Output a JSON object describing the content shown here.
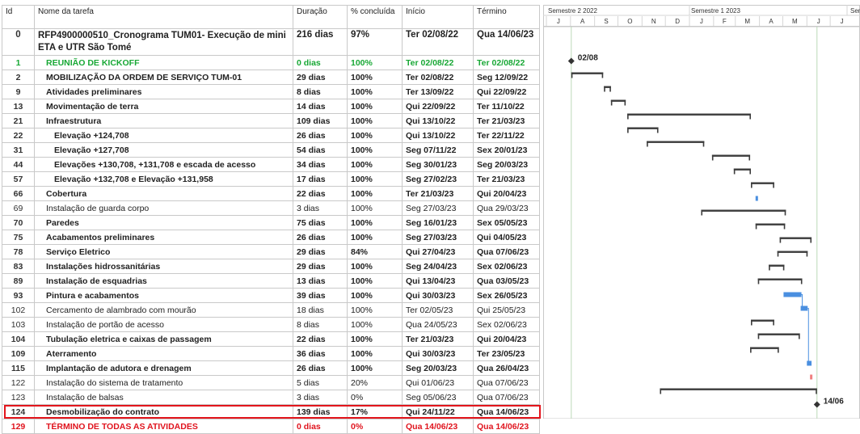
{
  "columns": [
    "Id",
    "Nome da tarefa",
    "Duração",
    "% concluída",
    "Início",
    "Término"
  ],
  "timescale": {
    "tiers": [
      "Semestre 2 2022",
      "Semestre 1 2023",
      "Seme"
    ],
    "months": [
      "J",
      "A",
      "S",
      "O",
      "N",
      "D",
      "J",
      "F",
      "M",
      "A",
      "M",
      "J",
      "J"
    ]
  },
  "tasks": [
    {
      "id": "0",
      "name": "RFP4900000510_Cronograma TUM01- Execução de mini ETA e UTR São Tomé",
      "duration": "216 dias",
      "pct": "97%",
      "start": "Ter 02/08/22",
      "end": "Qua 14/06/23",
      "style": "summary",
      "level": 0
    },
    {
      "id": "1",
      "name": "REUNIÃO DE KICKOFF",
      "duration": "0 dias",
      "pct": "100%",
      "start": "Ter 02/08/22",
      "end": "Ter 02/08/22",
      "style": "green",
      "level": 1
    },
    {
      "id": "2",
      "name": "MOBILIZAÇÃO DA ORDEM DE SERVIÇO TUM-01",
      "duration": "29 dias",
      "pct": "100%",
      "start": "Ter 02/08/22",
      "end": "Seg 12/09/22",
      "style": "bold",
      "level": 1
    },
    {
      "id": "9",
      "name": "Atividades preliminares",
      "duration": "8 dias",
      "pct": "100%",
      "start": "Ter 13/09/22",
      "end": "Qui 22/09/22",
      "style": "bold",
      "level": 1
    },
    {
      "id": "13",
      "name": "Movimentação de terra",
      "duration": "14 dias",
      "pct": "100%",
      "start": "Qui 22/09/22",
      "end": "Ter 11/10/22",
      "style": "bold",
      "level": 1
    },
    {
      "id": "21",
      "name": "Infraestrutura",
      "duration": "109 dias",
      "pct": "100%",
      "start": "Qui 13/10/22",
      "end": "Ter 21/03/23",
      "style": "bold",
      "level": 1
    },
    {
      "id": "22",
      "name": "Elevação +124,708",
      "duration": "26 dias",
      "pct": "100%",
      "start": "Qui 13/10/22",
      "end": "Ter 22/11/22",
      "style": "bold",
      "level": 2
    },
    {
      "id": "31",
      "name": "Elevação +127,708",
      "duration": "54 dias",
      "pct": "100%",
      "start": "Seg 07/11/22",
      "end": "Sex 20/01/23",
      "style": "bold",
      "level": 2
    },
    {
      "id": "44",
      "name": "Elevações +130,708, +131,708 e escada de acesso",
      "duration": "34 dias",
      "pct": "100%",
      "start": "Seg 30/01/23",
      "end": "Seg 20/03/23",
      "style": "bold",
      "level": 2
    },
    {
      "id": "57",
      "name": "Elevação +132,708 e Elevação +131,958",
      "duration": "17 dias",
      "pct": "100%",
      "start": "Seg 27/02/23",
      "end": "Ter 21/03/23",
      "style": "bold",
      "level": 2
    },
    {
      "id": "66",
      "name": "Cobertura",
      "duration": "22 dias",
      "pct": "100%",
      "start": "Ter 21/03/23",
      "end": "Qui 20/04/23",
      "style": "bold",
      "level": 1
    },
    {
      "id": "69",
      "name": "Instalação de guarda corpo",
      "duration": "3 dias",
      "pct": "100%",
      "start": "Seg 27/03/23",
      "end": "Qua 29/03/23",
      "style": "normal",
      "level": 1
    },
    {
      "id": "70",
      "name": "Paredes",
      "duration": "75 dias",
      "pct": "100%",
      "start": "Seg 16/01/23",
      "end": "Sex 05/05/23",
      "style": "bold",
      "level": 1
    },
    {
      "id": "75",
      "name": "Acabamentos preliminares",
      "duration": "26 dias",
      "pct": "100%",
      "start": "Seg 27/03/23",
      "end": "Qui 04/05/23",
      "style": "bold",
      "level": 1
    },
    {
      "id": "78",
      "name": "Serviço Eletrico",
      "duration": "29 dias",
      "pct": "84%",
      "start": "Qui 27/04/23",
      "end": "Qua 07/06/23",
      "style": "bold",
      "level": 1
    },
    {
      "id": "83",
      "name": "Instalações hidrossanitárias",
      "duration": "29 dias",
      "pct": "100%",
      "start": "Seg 24/04/23",
      "end": "Sex 02/06/23",
      "style": "bold",
      "level": 1
    },
    {
      "id": "89",
      "name": "Instalação de esquadrias",
      "duration": "13 dias",
      "pct": "100%",
      "start": "Qui 13/04/23",
      "end": "Qua 03/05/23",
      "style": "bold",
      "level": 1
    },
    {
      "id": "93",
      "name": "Pintura e acabamentos",
      "duration": "39 dias",
      "pct": "100%",
      "start": "Qui 30/03/23",
      "end": "Sex 26/05/23",
      "style": "bold",
      "level": 1
    },
    {
      "id": "102",
      "name": "Cercamento de alambrado com mourão",
      "duration": "18 dias",
      "pct": "100%",
      "start": "Ter 02/05/23",
      "end": "Qui 25/05/23",
      "style": "normal",
      "level": 1
    },
    {
      "id": "103",
      "name": "Instalação de portão de acesso",
      "duration": "8 dias",
      "pct": "100%",
      "start": "Qua 24/05/23",
      "end": "Sex 02/06/23",
      "style": "normal",
      "level": 1
    },
    {
      "id": "104",
      "name": "Tubulação eletrica e caixas de passagem",
      "duration": "22 dias",
      "pct": "100%",
      "start": "Ter 21/03/23",
      "end": "Qui 20/04/23",
      "style": "bold",
      "level": 1
    },
    {
      "id": "109",
      "name": "Aterramento",
      "duration": "36 dias",
      "pct": "100%",
      "start": "Qui 30/03/23",
      "end": "Ter 23/05/23",
      "style": "bold",
      "level": 1
    },
    {
      "id": "115",
      "name": "Implantação de adutora e drenagem",
      "duration": "26 dias",
      "pct": "100%",
      "start": "Seg 20/03/23",
      "end": "Qua 26/04/23",
      "style": "bold",
      "level": 1
    },
    {
      "id": "122",
      "name": "Instalação do sistema de tratamento",
      "duration": "5 dias",
      "pct": "20%",
      "start": "Qui 01/06/23",
      "end": "Qua 07/06/23",
      "style": "normal",
      "level": 1
    },
    {
      "id": "123",
      "name": "Instalação de balsas",
      "duration": "3 dias",
      "pct": "0%",
      "start": "Seg 05/06/23",
      "end": "Qua 07/06/23",
      "style": "normal",
      "level": 1
    },
    {
      "id": "124",
      "name": "Desmobilização do contrato",
      "duration": "139 dias",
      "pct": "17%",
      "start": "Qui 24/11/22",
      "end": "Qua 14/06/23",
      "style": "bold",
      "level": 1
    },
    {
      "id": "129",
      "name": "TÉRMINO DE TODAS AS ATIVIDADES",
      "duration": "0 dias",
      "pct": "0%",
      "start": "Qua 14/06/23",
      "end": "Qua 14/06/23",
      "style": "red",
      "level": 1
    }
  ],
  "chart_data": {
    "type": "gantt",
    "timeline_start": "2022-07-01",
    "timeline_end": "2023-07-31",
    "bars": [
      {
        "id": "2",
        "start": "2022-08-02",
        "end": "2022-09-12",
        "color": "#3c3c3c"
      },
      {
        "id": "9",
        "start": "2022-09-13",
        "end": "2022-09-22",
        "color": "#3c3c3c"
      },
      {
        "id": "13",
        "start": "2022-09-22",
        "end": "2022-10-11",
        "color": "#3c3c3c"
      },
      {
        "id": "21",
        "start": "2022-10-13",
        "end": "2023-03-21",
        "color": "#3c3c3c"
      },
      {
        "id": "22",
        "start": "2022-10-13",
        "end": "2022-11-22",
        "color": "#3c3c3c"
      },
      {
        "id": "31",
        "start": "2022-11-07",
        "end": "2023-01-20",
        "color": "#3c3c3c"
      },
      {
        "id": "44",
        "start": "2023-01-30",
        "end": "2023-03-20",
        "color": "#3c3c3c"
      },
      {
        "id": "57",
        "start": "2023-02-27",
        "end": "2023-03-21",
        "color": "#3c3c3c"
      },
      {
        "id": "66",
        "start": "2023-03-21",
        "end": "2023-04-20",
        "color": "#3c3c3c"
      },
      {
        "id": "69",
        "start": "2023-03-27",
        "end": "2023-03-29",
        "color": "#4a8fe0"
      },
      {
        "id": "70",
        "start": "2023-01-16",
        "end": "2023-05-05",
        "color": "#3c3c3c"
      },
      {
        "id": "75",
        "start": "2023-03-27",
        "end": "2023-05-04",
        "color": "#3c3c3c"
      },
      {
        "id": "78",
        "start": "2023-04-27",
        "end": "2023-06-07",
        "color": "#3c3c3c"
      },
      {
        "id": "83",
        "start": "2023-04-24",
        "end": "2023-06-02",
        "color": "#3c3c3c"
      },
      {
        "id": "89",
        "start": "2023-04-13",
        "end": "2023-05-03",
        "color": "#3c3c3c"
      },
      {
        "id": "93",
        "start": "2023-03-30",
        "end": "2023-05-26",
        "color": "#3c3c3c"
      },
      {
        "id": "102",
        "start": "2023-05-02",
        "end": "2023-05-25",
        "color": "#4a8fe0"
      },
      {
        "id": "103",
        "start": "2023-05-24",
        "end": "2023-06-02",
        "color": "#4a8fe0"
      },
      {
        "id": "104",
        "start": "2023-03-21",
        "end": "2023-04-20",
        "color": "#3c3c3c"
      },
      {
        "id": "109",
        "start": "2023-03-30",
        "end": "2023-05-23",
        "color": "#3c3c3c"
      },
      {
        "id": "115",
        "start": "2023-03-20",
        "end": "2023-04-26",
        "color": "#3c3c3c"
      },
      {
        "id": "122",
        "start": "2023-06-01",
        "end": "2023-06-07",
        "color": "#4a8fe0"
      },
      {
        "id": "123",
        "start": "2023-06-05",
        "end": "2023-06-07",
        "color": "#f08080"
      },
      {
        "id": "124",
        "start": "2022-11-24",
        "end": "2023-06-14",
        "color": "#3c3c3c"
      }
    ],
    "milestones": [
      {
        "id": "1",
        "date": "2022-08-02",
        "label": "02/08"
      },
      {
        "id": "129",
        "date": "2023-06-14",
        "label": "14/06"
      }
    ]
  }
}
